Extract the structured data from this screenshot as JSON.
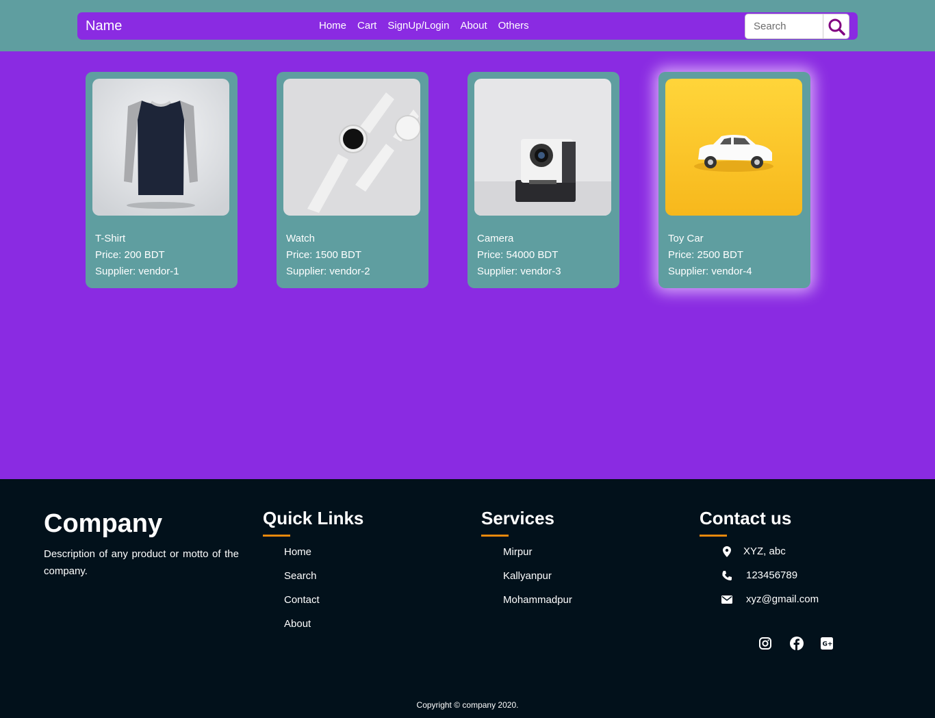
{
  "nav": {
    "brand": "Name",
    "links": [
      "Home",
      "Cart",
      "SignUp/Login",
      "About",
      "Others"
    ],
    "search_placeholder": "Search"
  },
  "products": [
    {
      "name": "T-Shirt",
      "price": "Price: 200 BDT",
      "supplier": "Supplier: vendor-1"
    },
    {
      "name": "Watch",
      "price": "Price: 1500 BDT",
      "supplier": "Supplier: vendor-2"
    },
    {
      "name": "Camera",
      "price": "Price: 54000 BDT",
      "supplier": "Supplier: vendor-3"
    },
    {
      "name": "Toy Car",
      "price": "Price: 2500 BDT",
      "supplier": "Supplier: vendor-4"
    }
  ],
  "footer": {
    "company": {
      "title": "Company",
      "description": "Description of any product or motto of the company."
    },
    "quick_links": {
      "title": "Quick Links",
      "items": [
        "Home",
        "Search",
        "Contact",
        "About"
      ]
    },
    "services": {
      "title": "Services",
      "items": [
        "Mirpur",
        "Kallyanpur",
        "Mohammadpur"
      ]
    },
    "contact": {
      "title": "Contact us",
      "address": "XYZ, abc",
      "phone": "123456789",
      "email": "xyz@gmail.com"
    },
    "social_icons": [
      "instagram-icon",
      "facebook-icon",
      "google-plus-icon"
    ],
    "copyright": "Copyright © company 2020."
  },
  "colors": {
    "page_bg": "#8a2be2",
    "header_bg": "#5f9ea0",
    "card_bg": "#5f9ea0",
    "footer_bg": "#02111b",
    "accent": "#e8890c"
  }
}
